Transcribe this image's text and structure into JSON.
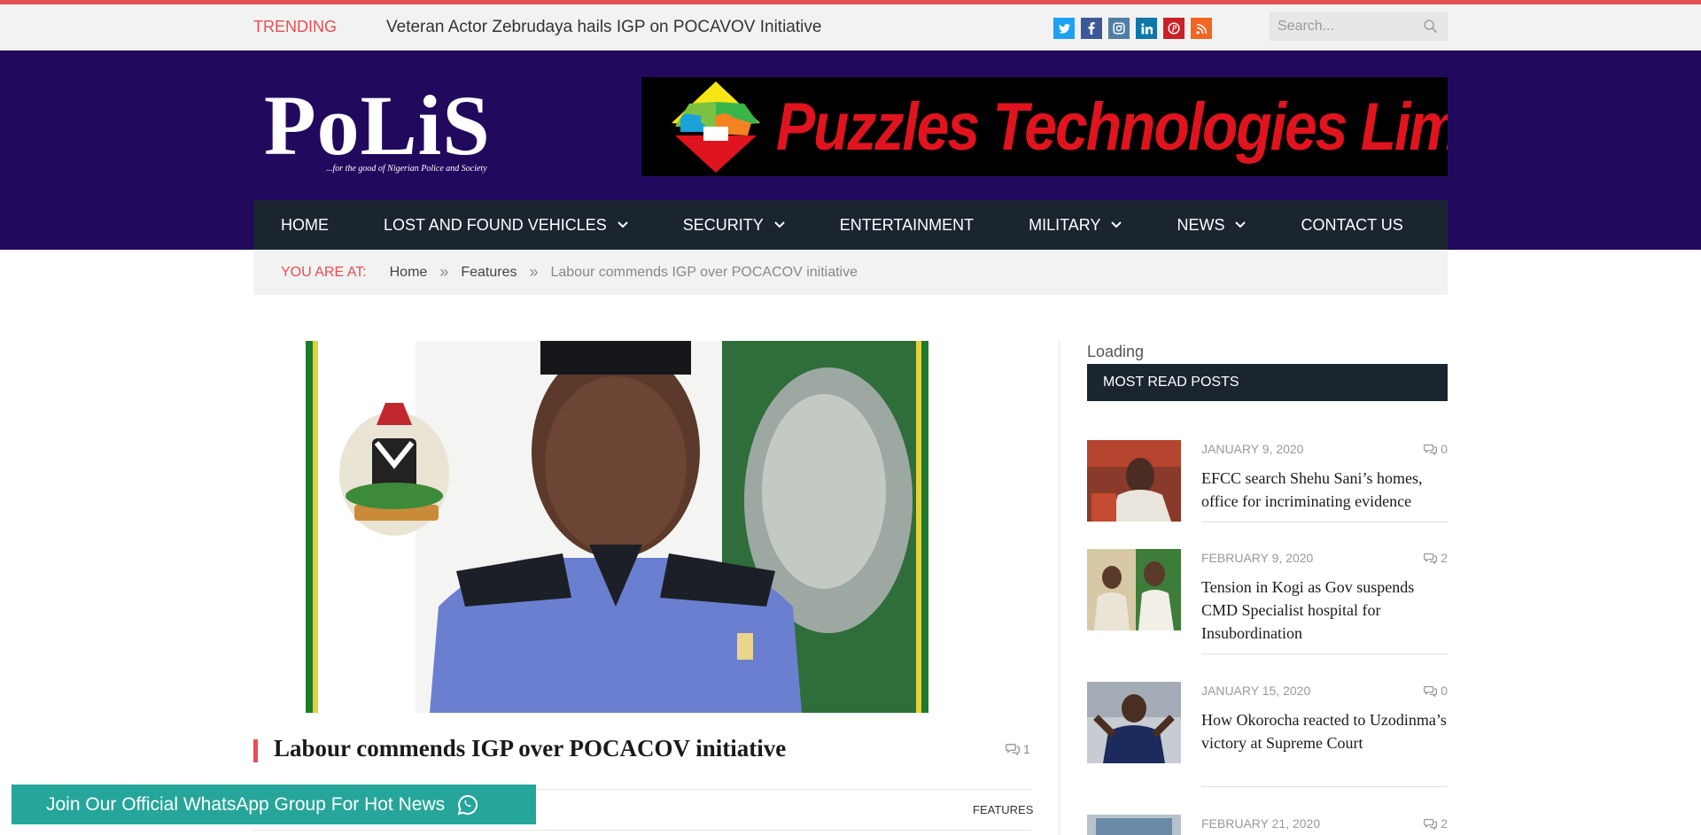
{
  "topbar": {
    "trending_label": "TRENDING",
    "trending_headline": "Veteran Actor Zebrudaya hails IGP on POCAVOV Initiative",
    "social": [
      {
        "name": "twitter-icon",
        "glyph": "t",
        "color": "#1da1f2"
      },
      {
        "name": "facebook-icon",
        "glyph": "f",
        "color": "#3b5998"
      },
      {
        "name": "instagram-icon",
        "glyph": "◎",
        "color": "#517fa4"
      },
      {
        "name": "linkedin-icon",
        "glyph": "in",
        "color": "#0e76a8"
      },
      {
        "name": "pinterest-icon",
        "glyph": "P",
        "color": "#cb2027"
      },
      {
        "name": "rss-icon",
        "glyph": "))",
        "color": "#f26522"
      }
    ],
    "search_placeholder": "Search..."
  },
  "header": {
    "logo_text": "PoLiS",
    "logo_tagline": "...for the good of Nigerian Police and Society",
    "ad_text": "Puzzles Technologies Limited"
  },
  "nav": {
    "items": [
      {
        "label": "HOME",
        "has_dropdown": false
      },
      {
        "label": "LOST AND FOUND VEHICLES",
        "has_dropdown": true
      },
      {
        "label": "SECURITY",
        "has_dropdown": true
      },
      {
        "label": "ENTERTAINMENT",
        "has_dropdown": false
      },
      {
        "label": "MILITARY",
        "has_dropdown": true
      },
      {
        "label": "NEWS",
        "has_dropdown": true
      },
      {
        "label": "CONTACT US",
        "has_dropdown": false
      }
    ]
  },
  "breadcrumb": {
    "label": "YOU ARE AT:",
    "home": "Home",
    "section": "Features",
    "current": "Labour commends IGP over POCACOV initiative",
    "separator": "»"
  },
  "article": {
    "title": "Labour commends IGP over POCACOV initiative",
    "comments": "1",
    "category": "FEATURES"
  },
  "sidebar": {
    "loading": "Loading",
    "heading": "MOST READ POSTS",
    "posts": [
      {
        "date": "JANUARY 9, 2020",
        "comments": "0",
        "title": "EFCC search Shehu Sani’s homes, office for incriminating evidence"
      },
      {
        "date": "FEBRUARY 9, 2020",
        "comments": "2",
        "title": "Tension in Kogi as Gov suspends CMD Specialist hospital for Insubordination"
      },
      {
        "date": "JANUARY 15, 2020",
        "comments": "0",
        "title": "How Okorocha reacted to Uzodinma’s victory at Supreme Court"
      },
      {
        "date": "FEBRUARY 21, 2020",
        "comments": "2",
        "title": ""
      }
    ]
  },
  "whatsapp": {
    "label": "Join Our Official WhatsApp Group For Hot News"
  },
  "colors": {
    "accent": "#e54e53",
    "header_bg": "#21095e",
    "nav_bg": "#1a2530",
    "whatsapp": "#26a69a"
  }
}
